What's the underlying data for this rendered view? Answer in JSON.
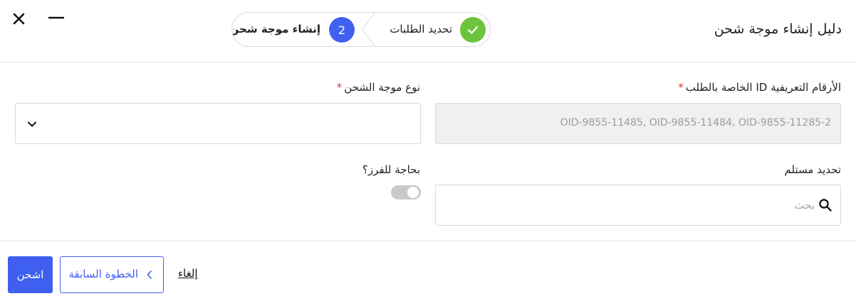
{
  "header": {
    "title": "دليل إنشاء موجة شحن",
    "close_icon": "close-icon",
    "minimize_icon": "minimize-icon"
  },
  "stepper": {
    "steps": [
      {
        "label": "تحديد الطلبات",
        "status": "completed",
        "icon": "check-icon"
      },
      {
        "number": "2",
        "label": "إنشاء موجة شحن",
        "status": "active"
      }
    ]
  },
  "form": {
    "order_ids": {
      "label": "الأرقام التعريفية ID الخاصة بالطلب",
      "required_mark": "*",
      "value": "OID-9855-11485, OID-9855-11484, OID-9855-11285-2"
    },
    "wave_type": {
      "label": "نوع موجة الشحن",
      "required_mark": "*",
      "value": ""
    },
    "recipient": {
      "label": "تحديد مستلم",
      "placeholder": "بحث"
    },
    "sorting": {
      "label": "بحاجة للفرز؟",
      "enabled": false
    }
  },
  "footer": {
    "ship_label": "اشحن",
    "previous_label": "الخطوة السابقة",
    "cancel_label": "إلغاء"
  },
  "colors": {
    "primary": "#3f5ff0",
    "success": "#6dc33b",
    "required": "#e0343a"
  }
}
